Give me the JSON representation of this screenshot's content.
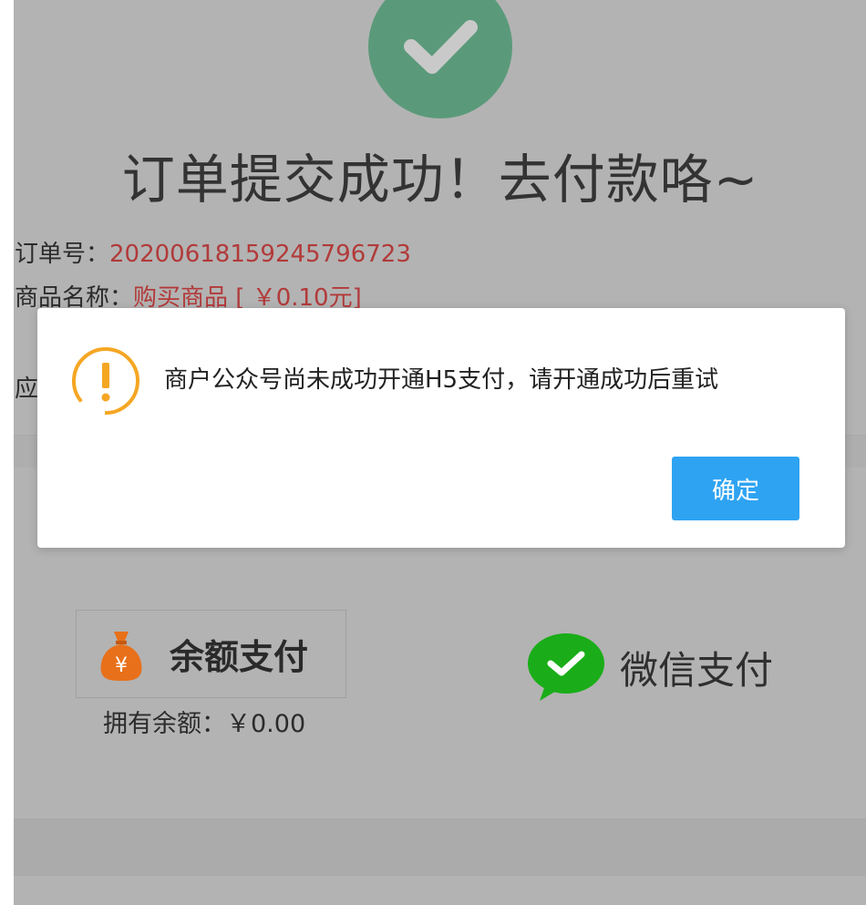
{
  "header": {
    "title": "订单提交成功！去付款咯~"
  },
  "order": {
    "number_label": "订单号：",
    "number_value": "20200618159245796723",
    "product_label": "商品名称：",
    "product_value": "购买商品 [ ￥0.10元]",
    "partial_label": "应"
  },
  "payment": {
    "balance_label": "余额支付",
    "balance_amount": "拥有余额：￥0.00",
    "wechat_label": "微信支付"
  },
  "dialog": {
    "message": "商户公众号尚未成功开通H5支付，请开通成功后重试",
    "confirm_label": "确定"
  },
  "colors": {
    "overlay": "#b3b3b3",
    "success_green": "#5a9a7a",
    "warning_orange": "#f5a623",
    "confirm_blue": "#2ea3f2",
    "order_red": "#b23a3a",
    "wechat_green": "#1aad19"
  }
}
